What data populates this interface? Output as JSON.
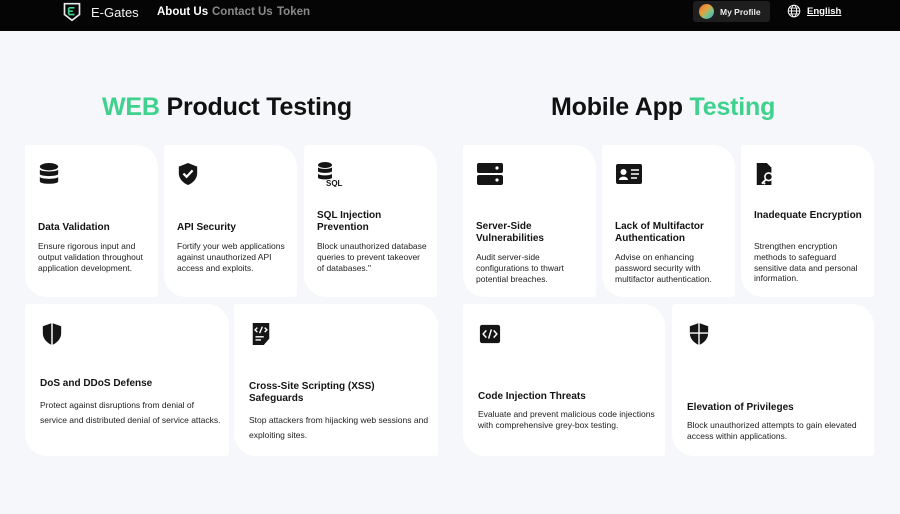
{
  "nav": {
    "brand": "E-Gates",
    "links": [
      "About Us",
      "Contact Us",
      "Token"
    ],
    "profile_label": "My Profile",
    "language": "English"
  },
  "web": {
    "title_accent": "WEB",
    "title_rest": "Product Testing",
    "cards": [
      {
        "icon": "database-icon",
        "title": "Data Validation",
        "desc": "Ensure rigorous input and output validation throughout application development."
      },
      {
        "icon": "shield-check-icon",
        "title": "API Security",
        "desc": "Fortify your web applications against unauthorized API access and exploits."
      },
      {
        "icon": "sql-database-icon",
        "title": "SQL Injection Prevention",
        "desc": "Block unauthorized database queries to prevent takeover of databases.\""
      },
      {
        "icon": "shield-icon",
        "title": "DoS and DDoS Defense",
        "desc": "Protect against disruptions from denial of service and distributed denial of service attacks."
      },
      {
        "icon": "code-file-icon",
        "title": "Cross-Site Scripting (XSS) Safeguards",
        "desc": "Stop attackers from hijacking web sessions and exploiting sites."
      }
    ]
  },
  "mobile": {
    "title_rest": "Mobile App",
    "title_accent": "Testing",
    "cards": [
      {
        "icon": "server-icon",
        "title": "Server-Side Vulnerabilities",
        "desc": "Audit server-side configurations to thwart potential breaches."
      },
      {
        "icon": "id-card-icon",
        "title": "Lack of Multifactor Authentication",
        "desc": "Advise on enhancing password security with multifactor authentication."
      },
      {
        "icon": "file-key-icon",
        "title": "Inadequate Encryption",
        "desc": "Strengthen encryption methods to safeguard sensitive data and personal information."
      },
      {
        "icon": "code-icon",
        "title": "Code Injection Threats",
        "desc": "Evaluate and prevent malicious code injections with comprehensive grey-box testing."
      },
      {
        "icon": "shield-halved-icon",
        "title": "Elevation of Privileges",
        "desc": "Block unauthorized attempts to gain elevated access within applications."
      }
    ]
  }
}
